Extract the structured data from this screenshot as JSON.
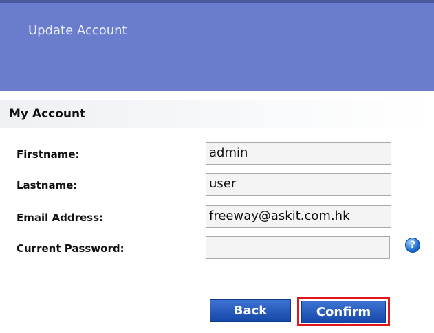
{
  "header": {
    "title": "Update Account"
  },
  "section": {
    "title": "My Account"
  },
  "form": {
    "firstname": {
      "label": "Firstname:",
      "value": "admin"
    },
    "lastname": {
      "label": "Lastname:",
      "value": "user"
    },
    "email": {
      "label": "Email Address:",
      "value": "freeway@askit.com.hk"
    },
    "password": {
      "label": "Current Password:",
      "value": ""
    },
    "help_icon": {
      "glyph": "?",
      "icon": "question-help-icon"
    }
  },
  "buttons": {
    "back": "Back",
    "confirm": "Confirm"
  },
  "colors": {
    "header_bg": "#6a7ccc",
    "button_bg": "#2a5cc0",
    "highlight": "#e0161e"
  }
}
